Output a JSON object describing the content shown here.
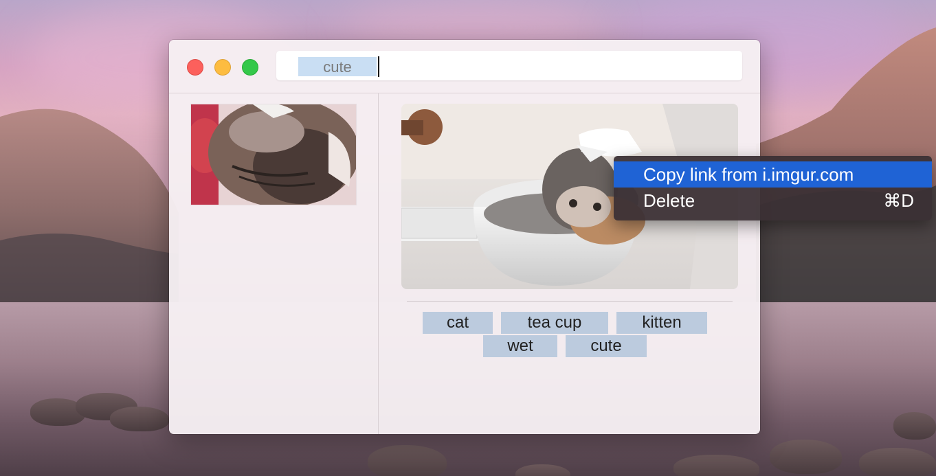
{
  "search": {
    "token": "cute"
  },
  "tags": [
    "cat",
    "tea cup",
    "kitten",
    "wet",
    "cute"
  ],
  "context_menu": {
    "items": [
      {
        "label": "Copy link from i.imgur.com",
        "shortcut": ""
      },
      {
        "label": "Delete",
        "shortcut": "⌘D"
      }
    ]
  },
  "colors": {
    "close": "#fc605c",
    "minimize": "#fdbc40",
    "zoom": "#34c84a",
    "token_bg": "#c9def3",
    "tag_bg": "#bccbde",
    "menu_highlight": "#1f63d5"
  }
}
